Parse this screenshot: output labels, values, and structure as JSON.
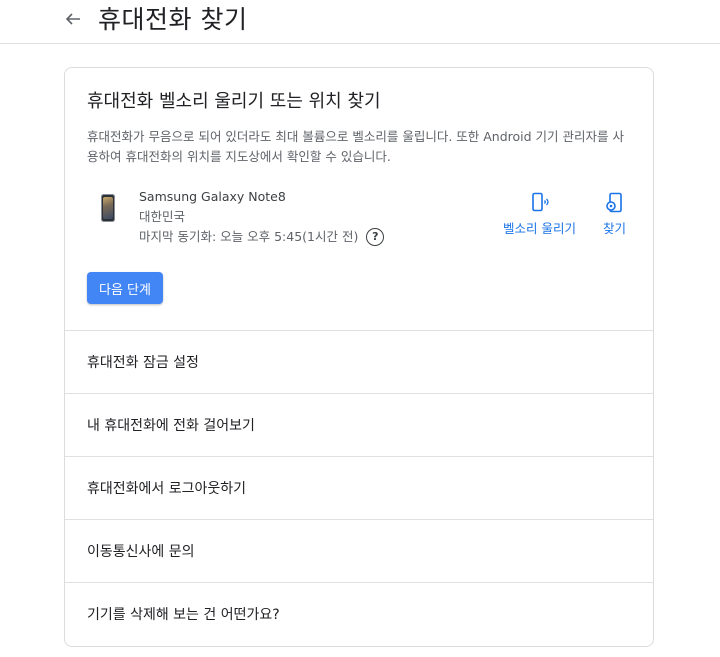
{
  "header": {
    "title": "휴대전화 찾기",
    "back_icon": "arrow-back-icon"
  },
  "ring_card": {
    "title": "휴대전화 벨소리 울리기 또는 위치 찾기",
    "description": "휴대전화가 무음으로 되어 있더라도 최대 볼륨으로 벨소리를 울립니다. 또한 Android 기기 관리자를 사용하여 휴대전화의 위치를 지도상에서 확인할 수 있습니다.",
    "device": {
      "name": "Samsung Galaxy Note8",
      "country": "대한민국",
      "last_sync": "마지막 동기화: 오늘 오후 5:45(1시간 전)"
    },
    "actions": {
      "ring_label": "벨소리 울리기",
      "find_label": "찾기"
    },
    "next_button": "다음 단계",
    "accent_color": "#1a73e8",
    "button_color": "#4285f4"
  },
  "options": [
    {
      "label": "휴대전화 잠금 설정"
    },
    {
      "label": "내 휴대전화에 전화 걸어보기"
    },
    {
      "label": "휴대전화에서 로그아웃하기"
    },
    {
      "label": "이동통신사에 문의"
    },
    {
      "label": "기기를 삭제해 보는 건 어떤가요?"
    }
  ]
}
